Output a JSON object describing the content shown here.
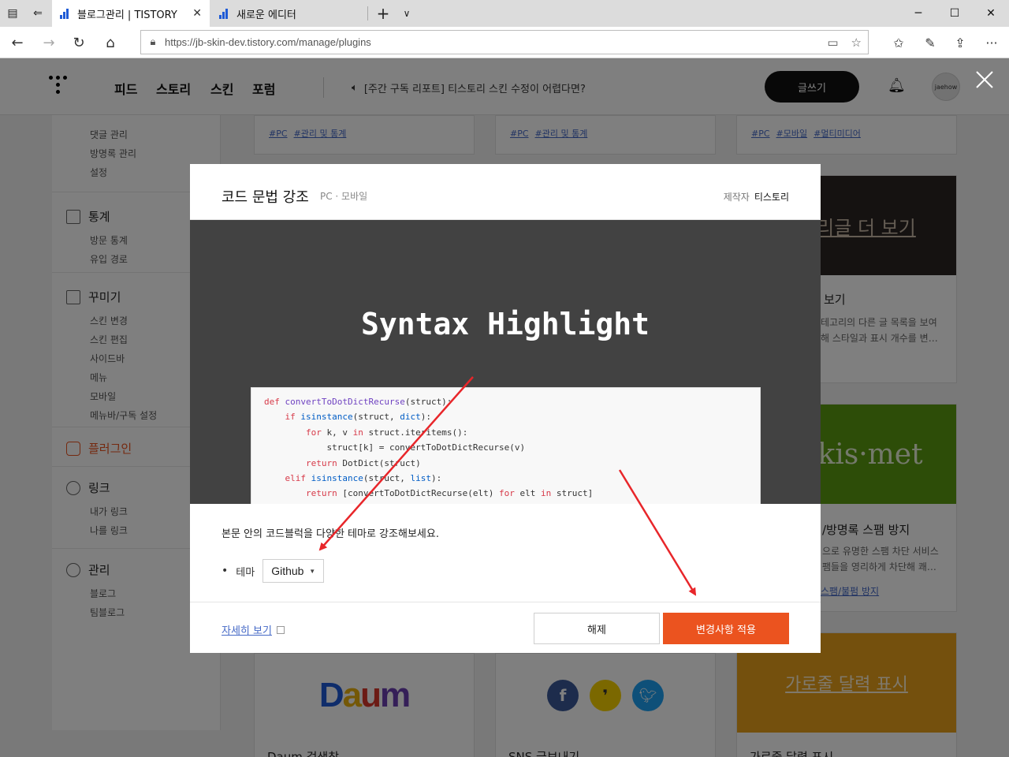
{
  "browser": {
    "tabs": [
      {
        "label": "블로그관리 | TISTORY",
        "active": true
      },
      {
        "label": "새로운 에디터",
        "active": false
      }
    ],
    "url": "https://jb-skin-dev.tistory.com/manage/plugins"
  },
  "tistory": {
    "menu": [
      "피드",
      "스토리",
      "스킨",
      "포럼"
    ],
    "notice": "[주간 구독 리포트] 티스토리 스킨 수정이 어렵다면?",
    "write_label": "글쓰기",
    "avatar_text": "jaehow"
  },
  "sidebar": {
    "top_items": [
      "댓글 관리",
      "방명록 관리",
      "설정"
    ],
    "groups": [
      {
        "title": "통계",
        "items": [
          "방문 통계",
          "유입 경로"
        ]
      },
      {
        "title": "꾸미기",
        "items": [
          "스킨 변경",
          "스킨 편집",
          "사이드바",
          "메뉴",
          "모바일",
          "메뉴바/구독 설정"
        ]
      },
      {
        "title": "플러그인",
        "items": []
      },
      {
        "title": "링크",
        "items": [
          "내가 링크",
          "나를 링크"
        ]
      },
      {
        "title": "관리",
        "items": [
          "블로그",
          "팀블로그"
        ]
      }
    ]
  },
  "cards": {
    "row1_tags": [
      [
        "#PC",
        "#관리 및 통계"
      ],
      [
        "#PC",
        "#관리 및 통계"
      ],
      [
        "#PC",
        "#모바일",
        "#멀티미디어"
      ]
    ],
    "right_cards": [
      {
        "thumb": "리글 더 보기",
        "title": "보기",
        "desc": [
          "테고리의 다른 글 목록을 보여",
          "해 스타일과 표시 개수를 변…"
        ]
      },
      {
        "thumb": "kis·met",
        "title": "/방명록 스팸 방지",
        "desc": [
          "으로 유명한 스팸 차단 서비스",
          "팸들을 영리하게 차단해 쾌…"
        ],
        "link": "스팸/불펌 방지"
      },
      {
        "thumb": "가로줄 달력 표시",
        "title": "가로줄 달력 표시"
      }
    ],
    "bottom_titles": [
      "Daum 검색창",
      "SNS 글보내기"
    ],
    "daum_logo": "Daum"
  },
  "modal": {
    "title": "코드 문법 강조",
    "platforms": "PC · 모바일",
    "maker_label": "제작자",
    "maker": "티스토리",
    "preview_title": "Syntax Highlight",
    "code_lines": [
      "def convertToDotDictRecurse(struct):",
      "    if isinstance(struct, dict):",
      "        for k, v in struct.iteritems():",
      "            struct[k] = convertToDotDictRecurse(v)",
      "        return DotDict(struct)",
      "    elif isinstance(struct, list):",
      "        return [convertToDotDictRecurse(elt) for elt in struct]"
    ],
    "description": "본문 안의 코드블럭을 다양한 테마로 강조해보세요.",
    "theme_label": "테마",
    "theme_value": "Github",
    "more_link": "자세히 보기",
    "btn_disable": "해제",
    "btn_apply": "변경사항 적용"
  },
  "colors": {
    "accent": "#eb531f",
    "annotation_arrow": "#e8262a"
  }
}
